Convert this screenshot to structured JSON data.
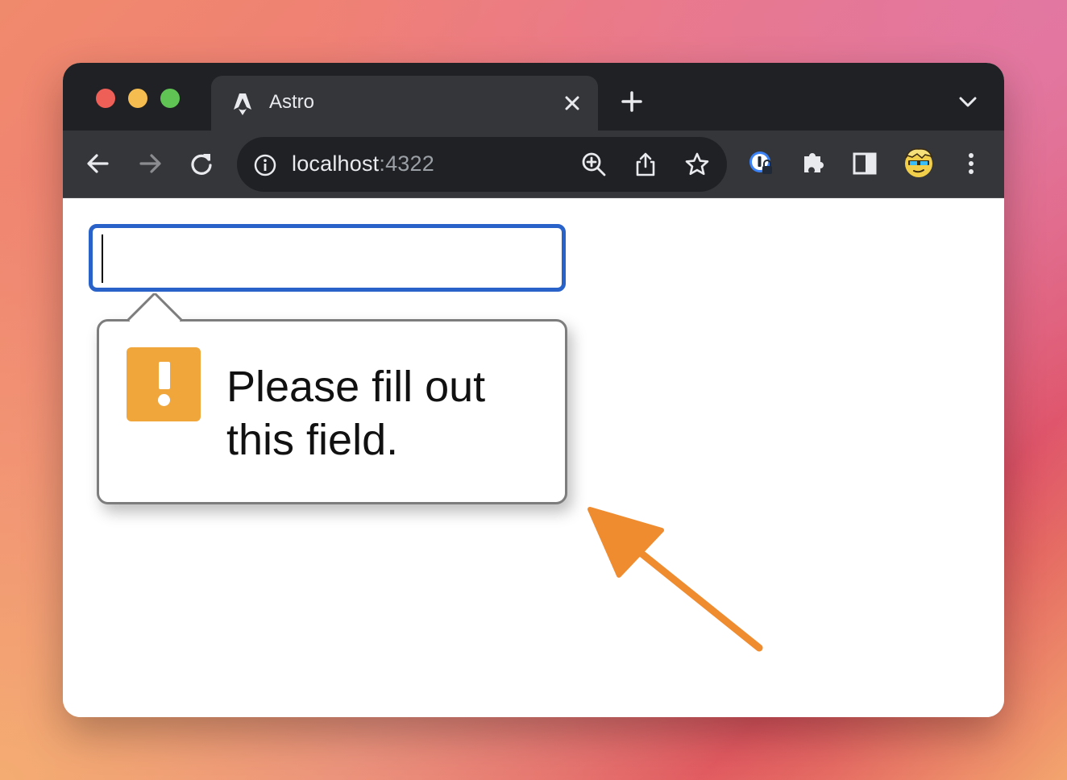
{
  "tab": {
    "title": "Astro"
  },
  "address_bar": {
    "host": "localhost",
    "port": ":4322"
  },
  "validation_popup": {
    "line1": "Please fill out",
    "line2": "this field."
  },
  "colors": {
    "focus_ring": "#2962c9",
    "warning_icon": "#f0a63a",
    "annotation_arrow": "#f08c30",
    "chrome_dark": "#202124",
    "chrome_toolbar": "#35363a"
  },
  "icons": [
    "astro-favicon-icon",
    "close-icon",
    "plus-icon",
    "chevron-down-icon",
    "back-arrow-icon",
    "forward-arrow-icon",
    "reload-icon",
    "info-icon",
    "zoom-in-icon",
    "share-icon",
    "star-icon",
    "password-manager-icon",
    "puzzle-piece-icon",
    "side-panel-icon",
    "avatar-icon",
    "kebab-menu-icon",
    "warning-icon",
    "annotation-arrow-icon"
  ]
}
